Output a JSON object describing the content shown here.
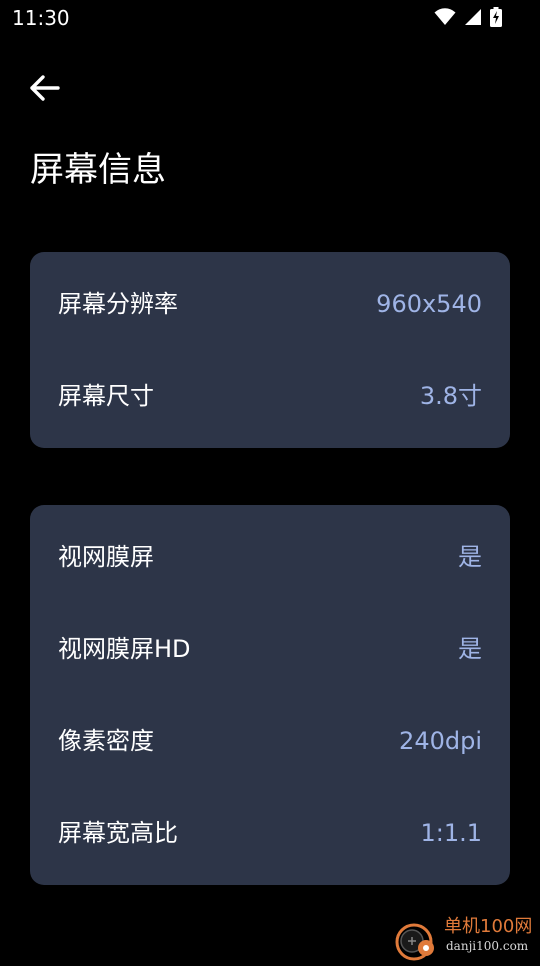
{
  "status_bar": {
    "time": "11:30",
    "icons": [
      "wifi-icon",
      "cellular-signal-icon",
      "battery-charging-icon"
    ]
  },
  "header": {
    "back_icon": "arrow-left-icon",
    "title": "屏幕信息"
  },
  "cards": [
    {
      "rows": [
        {
          "label": "屏幕分辨率",
          "value": "960x540"
        },
        {
          "label": "屏幕尺寸",
          "value": "3.8寸"
        }
      ]
    },
    {
      "rows": [
        {
          "label": "视网膜屏",
          "value": "是"
        },
        {
          "label": "视网膜屏HD",
          "value": "是"
        },
        {
          "label": "像素密度",
          "value": "240dpi"
        },
        {
          "label": "屏幕宽高比",
          "value": "1:1.1"
        }
      ]
    }
  ],
  "watermark": {
    "title": "单机100网",
    "url": "danji100.com"
  },
  "colors": {
    "background": "#000000",
    "card": "#2d3548",
    "label": "#ffffff",
    "value": "#9fb4e6",
    "watermark_accent": "#e07a3a"
  }
}
